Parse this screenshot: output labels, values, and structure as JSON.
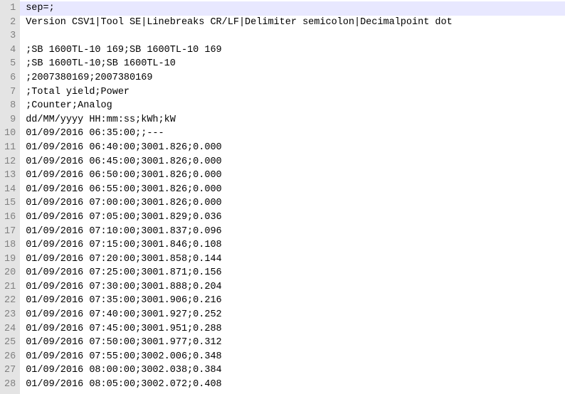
{
  "lines": [
    "sep=;",
    "Version CSV1|Tool SE|Linebreaks CR/LF|Delimiter semicolon|Decimalpoint dot",
    "",
    ";SB 1600TL-10 169;SB 1600TL-10 169",
    ";SB 1600TL-10;SB 1600TL-10",
    ";2007380169;2007380169",
    ";Total yield;Power",
    ";Counter;Analog",
    "dd/MM/yyyy HH:mm:ss;kWh;kW",
    "01/09/2016 06:35:00;;---",
    "01/09/2016 06:40:00;3001.826;0.000",
    "01/09/2016 06:45:00;3001.826;0.000",
    "01/09/2016 06:50:00;3001.826;0.000",
    "01/09/2016 06:55:00;3001.826;0.000",
    "01/09/2016 07:00:00;3001.826;0.000",
    "01/09/2016 07:05:00;3001.829;0.036",
    "01/09/2016 07:10:00;3001.837;0.096",
    "01/09/2016 07:15:00;3001.846;0.108",
    "01/09/2016 07:20:00;3001.858;0.144",
    "01/09/2016 07:25:00;3001.871;0.156",
    "01/09/2016 07:30:00;3001.888;0.204",
    "01/09/2016 07:35:00;3001.906;0.216",
    "01/09/2016 07:40:00;3001.927;0.252",
    "01/09/2016 07:45:00;3001.951;0.288",
    "01/09/2016 07:50:00;3001.977;0.312",
    "01/09/2016 07:55:00;3002.006;0.348",
    "01/09/2016 08:00:00;3002.038;0.384",
    "01/09/2016 08:05:00;3002.072;0.408"
  ],
  "highlight_index": 0,
  "line_numbers": [
    "1",
    "2",
    "3",
    "4",
    "5",
    "6",
    "7",
    "8",
    "9",
    "10",
    "11",
    "12",
    "13",
    "14",
    "15",
    "16",
    "17",
    "18",
    "19",
    "20",
    "21",
    "22",
    "23",
    "24",
    "25",
    "26",
    "27",
    "28"
  ]
}
